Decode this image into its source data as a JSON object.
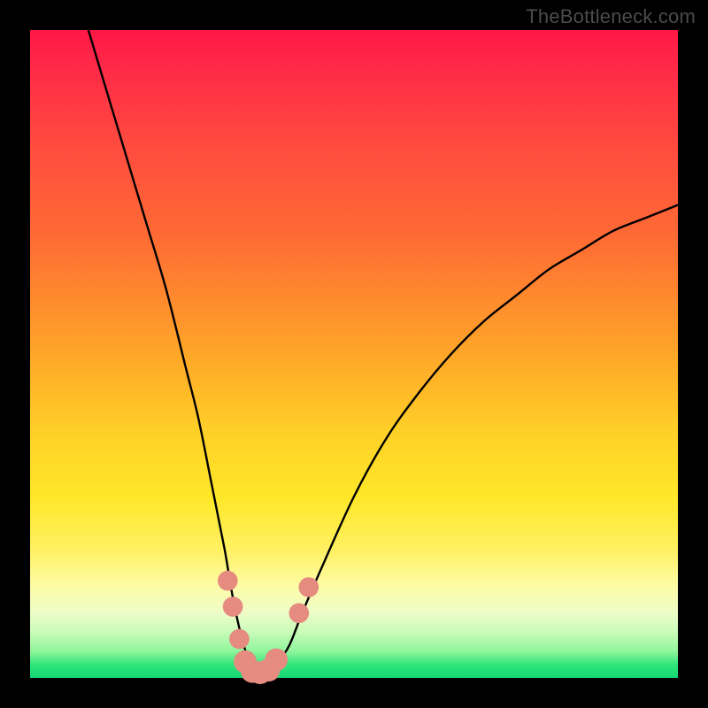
{
  "watermark": "TheBottleneck.com",
  "chart_data": {
    "type": "line",
    "title": "",
    "xlabel": "",
    "ylabel": "",
    "xlim": [
      0,
      100
    ],
    "ylim": [
      0,
      100
    ],
    "grid": false,
    "legend": false,
    "series": [
      {
        "name": "bottleneck-curve",
        "x": [
          9,
          12,
          15,
          18,
          21,
          24,
          26,
          28,
          30,
          31,
          32,
          33,
          34,
          35,
          36,
          37,
          38,
          40,
          42,
          45,
          50,
          55,
          60,
          65,
          70,
          75,
          80,
          85,
          90,
          95,
          100
        ],
        "y": [
          100,
          90,
          80,
          70,
          60,
          48,
          40,
          30,
          20,
          14,
          9,
          5,
          2,
          1,
          1,
          1,
          2,
          5,
          10,
          17,
          28,
          37,
          44,
          50,
          55,
          59,
          63,
          66,
          69,
          71,
          73
        ]
      }
    ],
    "markers": [
      {
        "x": 30.5,
        "y": 15,
        "r": 1.4
      },
      {
        "x": 31.3,
        "y": 11,
        "r": 1.4
      },
      {
        "x": 32.3,
        "y": 6,
        "r": 1.4
      },
      {
        "x": 33.2,
        "y": 2.5,
        "r": 1.6
      },
      {
        "x": 34.3,
        "y": 1.0,
        "r": 1.6
      },
      {
        "x": 35.5,
        "y": 0.8,
        "r": 1.6
      },
      {
        "x": 36.8,
        "y": 1.2,
        "r": 1.6
      },
      {
        "x": 38.0,
        "y": 2.8,
        "r": 1.6
      },
      {
        "x": 41.5,
        "y": 10,
        "r": 1.4
      },
      {
        "x": 43.0,
        "y": 14,
        "r": 1.4
      }
    ],
    "colors": {
      "curve": "#000000",
      "marker": "#e58b7f"
    }
  }
}
